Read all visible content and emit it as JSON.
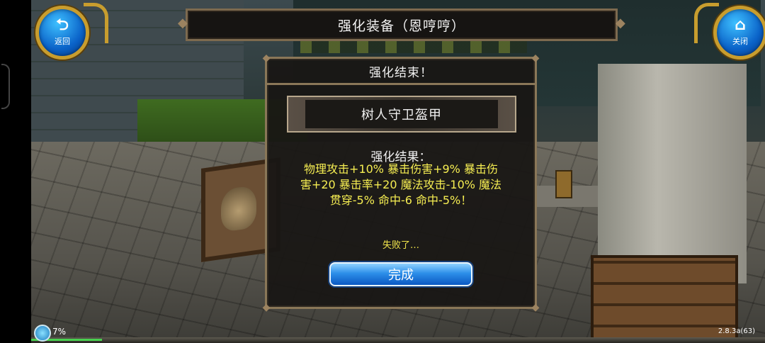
{
  "hud": {
    "back_label": "返回",
    "close_label": "关闭",
    "title": "强化装备（恩哼哼）",
    "percent": "7%",
    "version": "2.8.3a(63)"
  },
  "dialog": {
    "title": "强化结束！",
    "item_name": "树人守卫盔甲",
    "result_heading": "强化结果：",
    "result_lines": [
      "物理攻击+10% 暴击伤害+9% 暴击伤",
      "害+20 暴击率+20 魔法攻击-10% 魔法",
      "贯穿-5% 命中-6 命中-5%！"
    ],
    "fail_text": "失败了…",
    "done_label": "完成"
  },
  "colors": {
    "result_text": "#f6ee52",
    "button_blue": "#2d8fe9",
    "frame_gold": "#c89d2e"
  },
  "icons": {
    "back": "return-arrow-icon",
    "close": "home-icon",
    "status": "signal-status-icon"
  }
}
